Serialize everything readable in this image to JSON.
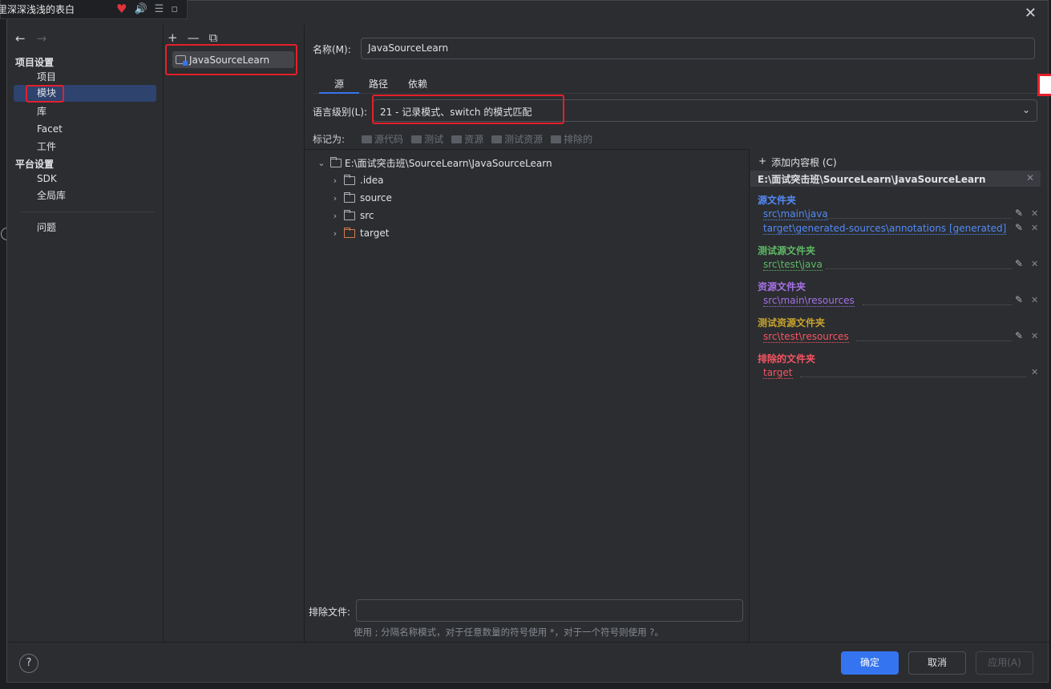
{
  "music": {
    "title": "里深深浅浅的表白",
    "heart": "♥",
    "volume": "🔊",
    "list": "☰",
    "mini": "▫"
  },
  "dialog": {
    "close": "✕"
  },
  "nav": {
    "back": "←",
    "forward": "→",
    "project_settings": "项目设置",
    "items_project": [
      "项目",
      "模块",
      "库",
      "Facet",
      "工件"
    ],
    "platform_settings": "平台设置",
    "items_platform": [
      "SDK",
      "全局库"
    ],
    "problems": "问题"
  },
  "modules": {
    "toolbar": {
      "add": "+",
      "remove": "—",
      "copy": "⧉"
    },
    "items": [
      "JavaSourceLearn"
    ]
  },
  "editor": {
    "name_label": "名称(M):",
    "name_value": "JavaSourceLearn",
    "tabs": [
      "源",
      "路径",
      "依赖"
    ],
    "lang_label": "语言级别(L):",
    "lang_value": "21 - 记录模式、switch 的模式匹配",
    "mark_as": "标记为:",
    "mark_buttons": [
      "源代码",
      "测试",
      "资源",
      "测试资源",
      "排除的"
    ],
    "tree": {
      "root": "E:\\面试突击班\\SourceLearn\\JavaSourceLearn",
      "children": [
        ".idea",
        "source",
        "src",
        "target"
      ]
    },
    "exclude_label": "排除文件:",
    "exclude_value": "",
    "hint": "使用 ; 分隔名称模式，对于任意数量的符号使用 *，对于一个符号则使用 ?。"
  },
  "content_roots": {
    "add_label": "添加内容根 (C)",
    "root_path": "E:\\面试突击班\\SourceLearn\\JavaSourceLearn",
    "sections": [
      {
        "title": "源文件夹",
        "color": "#548af7",
        "paths": [
          "src\\main\\java",
          "target\\generated-sources\\annotations [generated]"
        ]
      },
      {
        "title": "测试源文件夹",
        "color": "#5fb865",
        "paths": [
          "src\\test\\java"
        ]
      },
      {
        "title": "资源文件夹",
        "color": "#a571e6",
        "paths": [
          "src\\main\\resources"
        ]
      },
      {
        "title": "测试资源文件夹",
        "color": "#c7a32d",
        "paths": [
          "src\\test\\resources"
        ]
      },
      {
        "title": "排除的文件夹",
        "color": "#f75464",
        "paths": [
          "target"
        ]
      }
    ]
  },
  "footer": {
    "help": "?",
    "ok": "确定",
    "cancel": "取消",
    "apply": "应用(A)"
  }
}
